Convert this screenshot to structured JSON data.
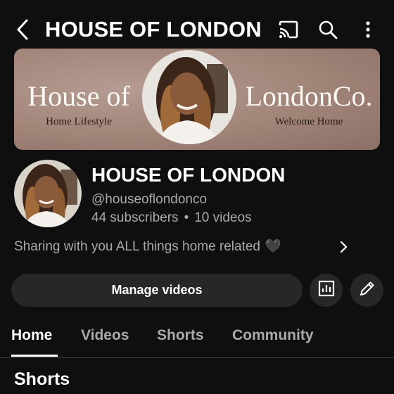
{
  "header": {
    "title": "HOUSE OF LONDON",
    "icons": [
      "back-arrow-icon",
      "cast-icon",
      "search-icon",
      "more-vertical-icon"
    ]
  },
  "banner": {
    "left_title": "House of",
    "left_subtitle": "Home Lifestyle",
    "right_title": "LondonCo.",
    "right_subtitle": "Welcome Home",
    "background_color": "#a18478"
  },
  "channel": {
    "name": "HOUSE OF LONDON",
    "handle": "@houseoflondonco",
    "subscribers": "44 subscribers",
    "separator": "•",
    "videos": "10 videos",
    "description": "Sharing with you ALL things home related",
    "description_emoji": "🖤"
  },
  "actions": {
    "manage_label": "Manage videos",
    "icons": [
      "analytics-icon",
      "edit-pencil-icon"
    ]
  },
  "tabs": [
    {
      "label": "Home",
      "active": true
    },
    {
      "label": "Videos",
      "active": false
    },
    {
      "label": "Shorts",
      "active": false
    },
    {
      "label": "Community",
      "active": false
    }
  ],
  "section": {
    "title": "Shorts"
  },
  "colors": {
    "background": "#0f0f0f",
    "secondary_text": "#aaaaaa",
    "button_bg": "#272727"
  }
}
